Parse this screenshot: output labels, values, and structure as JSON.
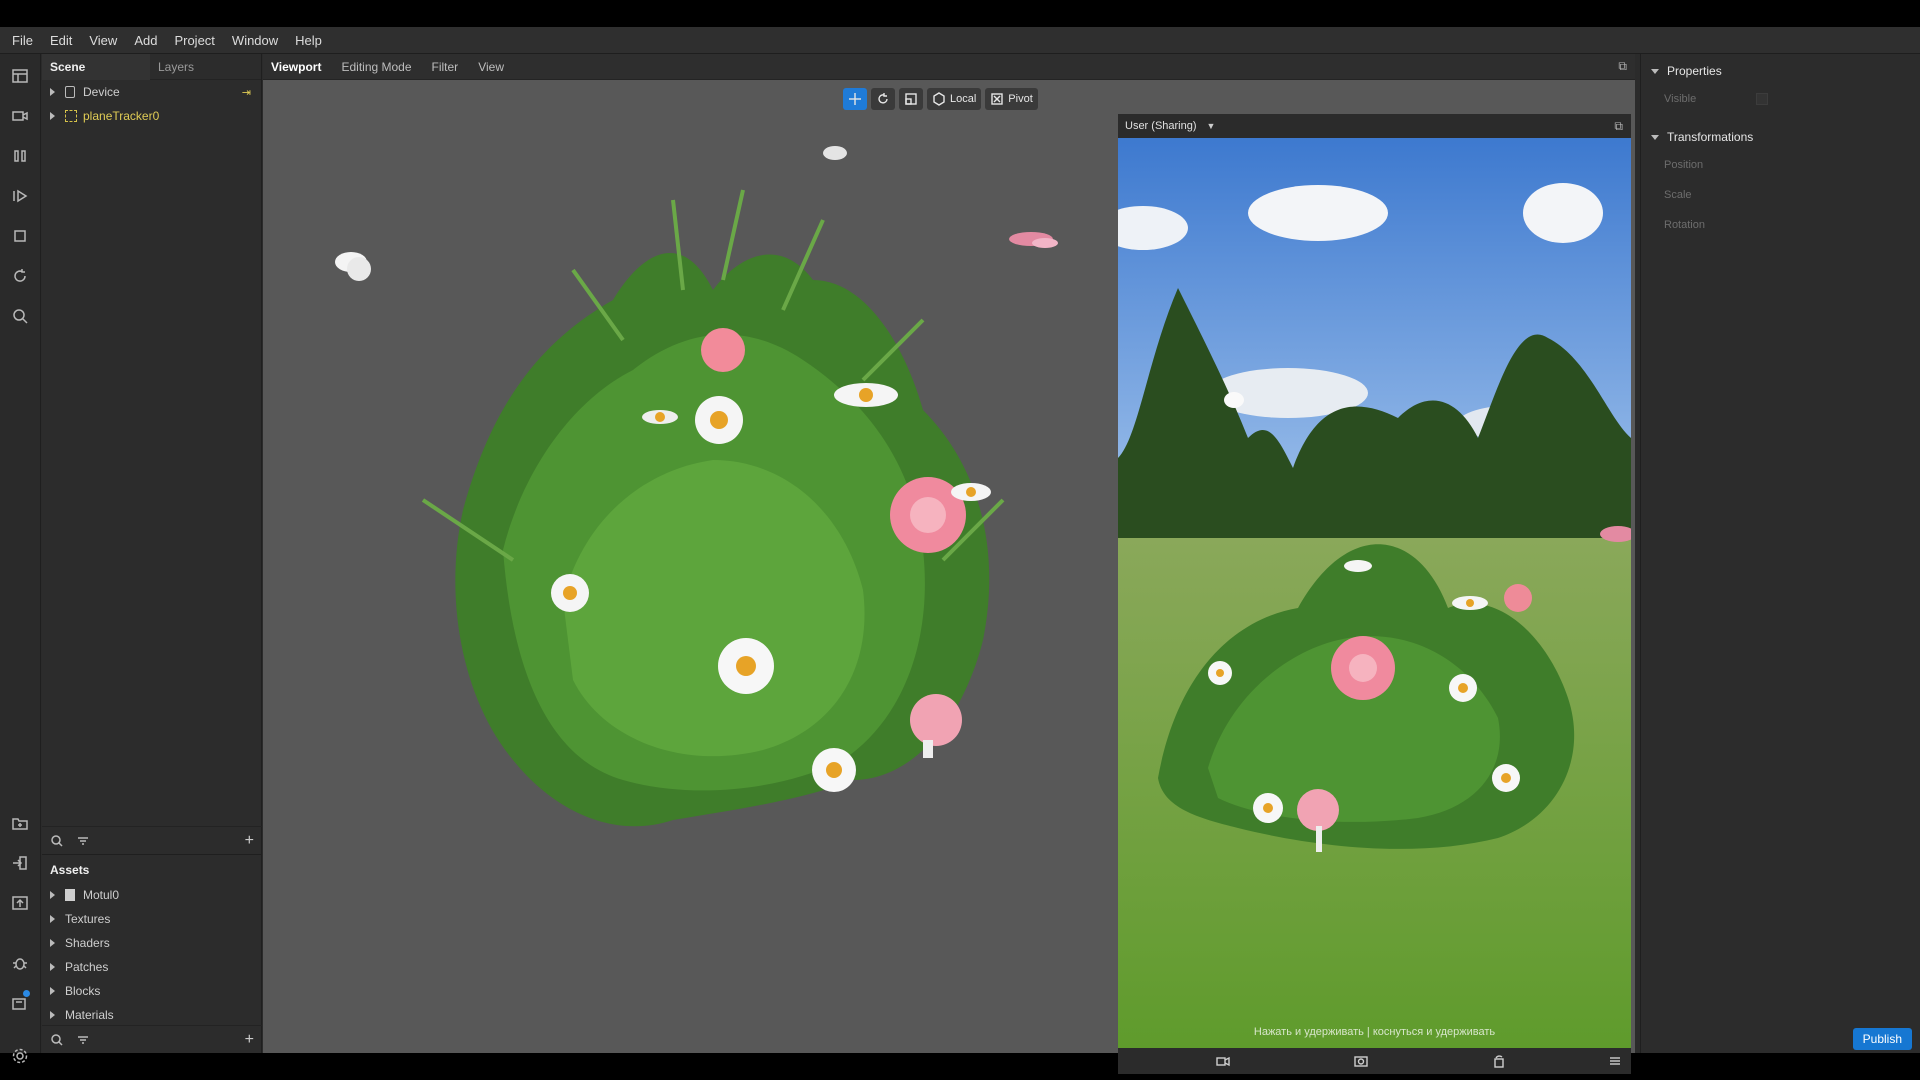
{
  "menu": [
    "File",
    "Edit",
    "View",
    "Add",
    "Project",
    "Window",
    "Help"
  ],
  "rail_icons": [
    "layout-icon",
    "camera-icon",
    "pause-icon",
    "play-icon",
    "square-icon",
    "refresh-icon",
    "search-icon",
    "import-icon",
    "login-icon",
    "upload-icon",
    "bug-icon",
    "device-icon",
    "gear-icon"
  ],
  "scene": {
    "tabs": [
      "Scene",
      "Layers"
    ],
    "items": [
      {
        "label": "Device"
      },
      {
        "label": "planeTracker0"
      }
    ]
  },
  "assets": {
    "title": "Assets",
    "items": [
      "Motul0",
      "Textures",
      "Shaders",
      "Patches",
      "Blocks",
      "Materials"
    ]
  },
  "viewport": {
    "tabs": [
      "Viewport",
      "Editing Mode",
      "Filter",
      "View"
    ],
    "local_label": "Local",
    "pivot_label": "Pivot"
  },
  "preview": {
    "device_label": "User (Sharing)",
    "hint": "Нажать и удерживать | коснуться и удерживать"
  },
  "properties": {
    "sections": [
      "Properties",
      "Transformations"
    ],
    "visible_label": "Visible",
    "fields": [
      "Position",
      "Scale",
      "Rotation"
    ]
  },
  "publish_label": "Publish",
  "colors": {
    "accent": "#1f7bd8",
    "viewport_bg": "#585858",
    "yellow_text": "#e0cc55"
  }
}
